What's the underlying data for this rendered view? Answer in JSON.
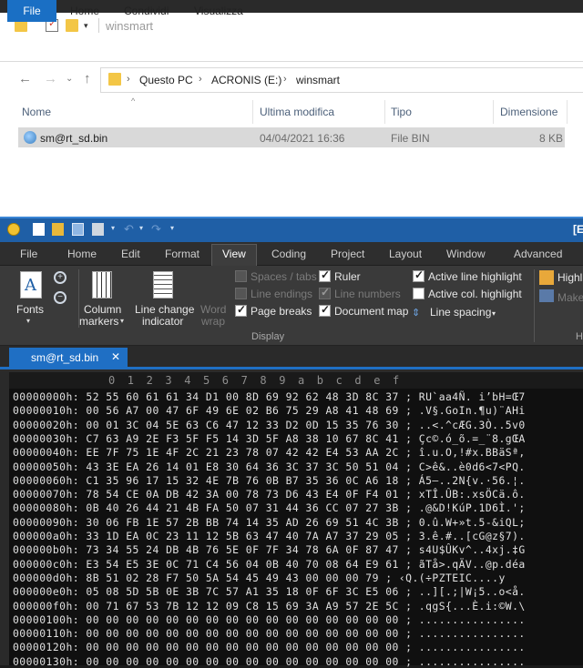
{
  "explorer": {
    "title": "winsmart",
    "ribbon_tabs": [
      "File",
      "Home",
      "Condividi",
      "Visualizza"
    ],
    "breadcrumb": [
      "Questo PC",
      "ACRONIS (E:)",
      "winsmart"
    ],
    "columns": [
      "Nome",
      "Ultima modifica",
      "Tipo",
      "Dimensione"
    ],
    "file": {
      "name": "sm@rt_sd.bin",
      "modified": "04/04/2021 16:36",
      "type": "File BIN",
      "size": "8 KB"
    }
  },
  "editor": {
    "title_fragment": "[E",
    "menu_tabs": [
      "File",
      "Home",
      "Edit",
      "Format",
      "View",
      "Coding",
      "Project",
      "Layout",
      "Window",
      "Advanced"
    ],
    "active_tab": "View",
    "ribbon": {
      "fonts": "Fonts",
      "column_markers_1": "Column",
      "column_markers_2": "markers",
      "line_change_1": "Line change",
      "line_change_2": "indicator",
      "word_wrap_1": "Word",
      "word_wrap_2": "wrap",
      "checks": [
        {
          "label": "Spaces / tabs",
          "checked": false,
          "disabled": true
        },
        {
          "label": "Line endings",
          "checked": false,
          "disabled": true
        },
        {
          "label": "Page breaks",
          "checked": true,
          "disabled": false
        },
        {
          "label": "Ruler",
          "checked": true,
          "disabled": false
        },
        {
          "label": "Line numbers",
          "checked": true,
          "disabled": true
        },
        {
          "label": "Document map",
          "checked": true,
          "disabled": false
        },
        {
          "label": "Active line highlight",
          "checked": true,
          "disabled": false
        },
        {
          "label": "Active col. highlight",
          "checked": false,
          "disabled": false
        }
      ],
      "line_spacing": "Line spacing",
      "highlight_fragment": "Highl",
      "make_fragment": "Make",
      "group_display": "Display",
      "group_h": "H"
    },
    "doc_tab": "sm@rt_sd.bin",
    "ruler": [
      "0",
      "1",
      "2",
      "3",
      "4",
      "5",
      "6",
      "7",
      "8",
      "9",
      "a",
      "b",
      "c",
      "d",
      "e",
      "f"
    ],
    "hex_lines": [
      "00000000h: 52 55 60 61 61 34 D1 00 8D 69 92 62 48 3D 8C 37 ; RU`aa4Ñ. i’bH=Œ7",
      "00000010h: 00 56 A7 00 47 6F 49 6E 02 B6 75 29 A8 41 48 69 ; .V§.GoIn.¶u)¨AHi",
      "00000020h: 00 01 3C 04 5E 63 C6 47 12 33 D2 0D 15 35 76 30 ; ..<.^cÆG.3Ò..5v0",
      "00000030h: C7 63 A9 2E F3 5F F5 14 3D 5F A8 38 10 67 8C 41 ; Çc©.ó_õ.=_¨8.gŒA",
      "00000040h: EE 7F 75 1E 4F 2C 21 23 78 07 42 42 E4 53 AA 2C ; î.u.O,!#x.BBäSª,",
      "00000050h: 43 3E EA 26 14 01 E8 30 64 36 3C 37 3C 50 51 04 ; C>ê&..è0d6<7<PQ.",
      "00000060h: C1 35 96 17 15 32 4E 7B 76 0B B7 35 36 0C A6 18 ; Á5–..2N{v.·56.¦.",
      "00000070h: 78 54 CE 0A DB 42 3A 00 78 73 D6 43 E4 0F F4 01 ; xTÎ.ÛB:.xsÖCä.ô.",
      "00000080h: 0B 40 26 44 21 4B FA 50 07 31 44 36 CC 07 27 3B ; .@&D!KúP.1D6Ì.';",
      "00000090h: 30 06 FB 1E 57 2B BB 74 14 35 AD 26 69 51 4C 3B ; 0.û.W+»t.5-&iQL;",
      "000000a0h: 33 1D EA 0C 23 11 12 5B 63 47 40 7A A7 37 29 05 ; 3.ê.#..[cG@z§7).",
      "000000b0h: 73 34 55 24 DB 4B 76 5E 0F 7F 34 78 6A 0F 87 47 ; s4U$ÛKv^..4xj.‡G",
      "000000c0h: E3 54 E5 3E 0C 71 C4 56 04 0B 40 70 08 64 E9 61 ; ãTå>.qÄV..@p.déa",
      "000000d0h: 8B 51 02 28 F7 50 5A 54 45 49 43 00 00 00 79 ; ‹Q.(÷PZTEIC....y",
      "000000e0h: 05 08 5D 5B 0E 3B 7C 57 A1 35 18 0F 6F 3C E5 06 ; ..][.;|W¡5..o<å.",
      "000000f0h: 00 71 67 53 7B 12 12 09 C8 15 69 3A A9 57 2E 5C ; .qgS{...È.i:©W.\\",
      "00000100h: 00 00 00 00 00 00 00 00 00 00 00 00 00 00 00 00 ; ................",
      "00000110h: 00 00 00 00 00 00 00 00 00 00 00 00 00 00 00 00 ; ................",
      "00000120h: 00 00 00 00 00 00 00 00 00 00 00 00 00 00 00 00 ; ................",
      "00000130h: 00 00 00 00 00 00 00 00 00 00 00 00 00 00 00 00 ; ................"
    ]
  },
  "colors": {
    "accent_blue": "#1f6fc4",
    "folder_yellow": "#f3c646"
  }
}
